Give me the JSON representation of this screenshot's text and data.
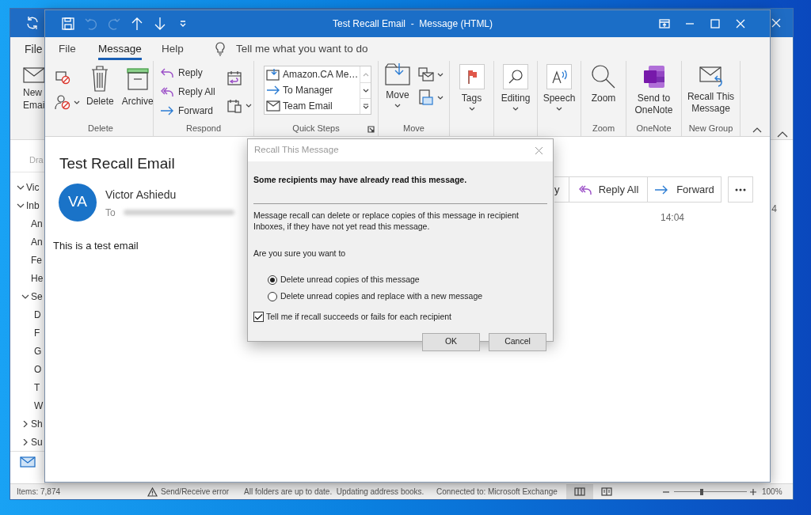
{
  "back_window": {
    "tabs": [
      {
        "label": "File"
      }
    ],
    "new_email": [
      "New",
      "Emai"
    ],
    "folder_pane": {
      "header": "Dra",
      "folders": [
        {
          "label": "Vic",
          "expanded": true,
          "children": [
            {
              "label": "Inb",
              "expanded": true,
              "children": [
                {
                  "label": "An"
                },
                {
                  "label": "An"
                },
                {
                  "label": "Fe"
                },
                {
                  "label": "He"
                },
                {
                  "label": "Se",
                  "expanded": true,
                  "children": [
                    {
                      "label": "D"
                    },
                    {
                      "label": "F"
                    },
                    {
                      "label": "G"
                    },
                    {
                      "label": "O"
                    },
                    {
                      "label": "T"
                    },
                    {
                      "label": "W"
                    }
                  ]
                },
                {
                  "label": "Sh",
                  "expanded": false
                },
                {
                  "label": "Su",
                  "expanded": false
                }
              ]
            }
          ]
        }
      ]
    },
    "message_list_fragment": "4",
    "status_bar": {
      "items": "Items: 7,874",
      "error": "Send/Receive error",
      "sync": "All folders are up to date.  Updating address books.",
      "connection": "Connected to: Microsoft Exchange",
      "zoom": {
        "level": 0.38,
        "reading": "100%"
      }
    }
  },
  "front_window": {
    "title": "Test Recall Email  -  Message (HTML)",
    "quick_access": [
      {
        "kind": "save",
        "disabled": false
      },
      {
        "kind": "undo",
        "disabled": true
      },
      {
        "kind": "redo",
        "disabled": true
      },
      {
        "kind": "up",
        "disabled": false
      },
      {
        "kind": "down",
        "disabled": false
      },
      {
        "kind": "customize",
        "disabled": false
      }
    ],
    "tabs": [
      {
        "label": "File",
        "selected": false
      },
      {
        "label": "Message",
        "selected": true
      },
      {
        "label": "Help",
        "selected": false
      }
    ],
    "tell_me": {
      "placeholder": "Tell me what you want to do"
    },
    "ribbon": [
      {
        "group": "Delete",
        "buttons": [
          "Delete",
          "Archive"
        ]
      },
      {
        "group": "Respond",
        "buttons": [
          "Reply",
          "Reply All",
          "Forward"
        ]
      },
      {
        "group": "Quick Steps",
        "buttons": [
          "Amazon.CA Me…",
          "To Manager",
          "Team Email"
        ]
      },
      {
        "group": "Move",
        "buttons": [
          "Move"
        ]
      },
      {
        "buttons": [
          "Tags"
        ]
      },
      {
        "buttons": [
          "Editing"
        ]
      },
      {
        "buttons": [
          "Speech"
        ]
      },
      {
        "group": "Zoom",
        "buttons": [
          "Zoom"
        ]
      },
      {
        "group": "OneNote",
        "buttons": [
          "Send to OneNote"
        ]
      },
      {
        "group": "New Group",
        "buttons": [
          "Recall This Message"
        ]
      }
    ],
    "message": {
      "subject": "Test Recall Email",
      "initials": "VA",
      "sender": "Victor Ashiedu",
      "to_label": "To",
      "body": "This is a test email",
      "actions": [
        "y",
        "Reply All",
        "Forward"
      ],
      "time": "14:04"
    }
  },
  "dialog": {
    "title": "Recall This Message",
    "heading": "Some recipients may have already read this message.",
    "description": "Message recall can delete or replace copies of this message in recipient Inboxes, if they have not yet read this message.",
    "question": "Are you sure you want to",
    "options": [
      {
        "label": "Delete unread copies of this message",
        "selected": true
      },
      {
        "label": "Delete unread copies and replace with a new message",
        "selected": false
      }
    ],
    "notify": {
      "label": "Tell me if recall succeeds or fails for each recipient",
      "checked": true
    },
    "buttons": [
      "OK",
      "Cancel"
    ]
  }
}
